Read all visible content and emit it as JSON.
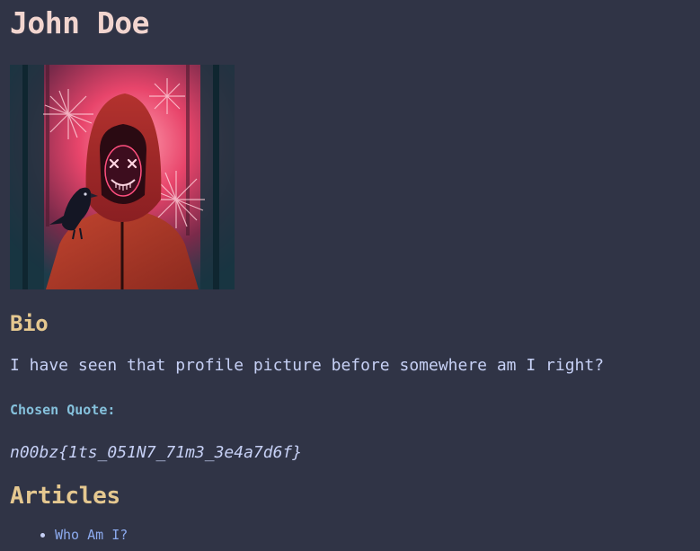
{
  "profile": {
    "name": "John Doe",
    "avatar_icon": "hooded-figure-neon-mask-avatar"
  },
  "bio": {
    "heading": "Bio",
    "text": "I have seen that profile picture before somewhere am I right?"
  },
  "quote": {
    "label": "Chosen Quote:",
    "text": "n00bz{1ts_051N7_71m3_3e4a7d6f}"
  },
  "articles": {
    "heading": "Articles",
    "items": [
      {
        "title": "Who Am I?"
      }
    ]
  },
  "colors": {
    "background": "#303446",
    "name": "#f2d5cf",
    "heading": "#e5c890",
    "text": "#c6d0f5",
    "label": "#85c1dc",
    "link": "#8caaee"
  }
}
